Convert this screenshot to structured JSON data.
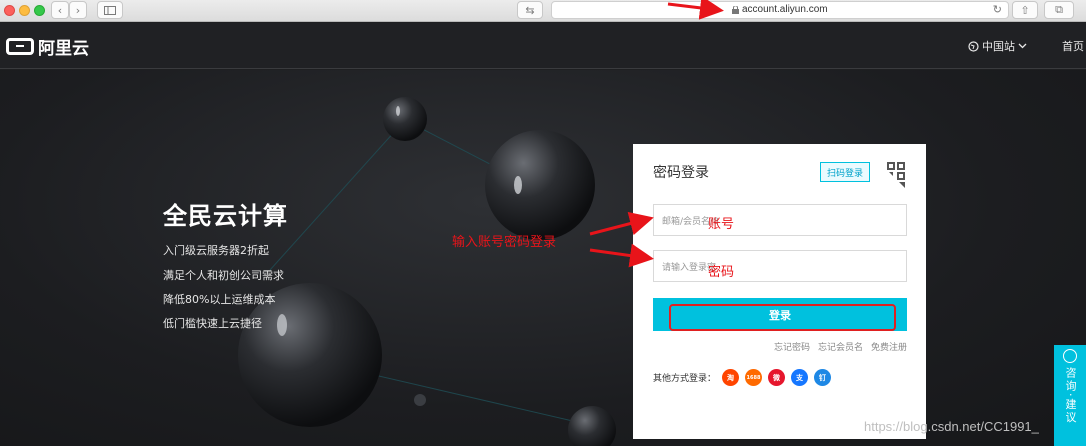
{
  "browser": {
    "url": "account.aliyun.com"
  },
  "header": {
    "logo_text": "阿里云",
    "region": "中国站",
    "home": "首页"
  },
  "hero": {
    "title": "全民云计算",
    "features": [
      "入门级云服务器2折起",
      "满足个人和初创公司需求",
      "降低80%以上运维成本",
      "低门槛快速上云捷径"
    ]
  },
  "login": {
    "title": "密码登录",
    "qr_tip": "扫码登录",
    "account_placeholder": "邮箱/会员名/8",
    "password_placeholder": "请输入登录密",
    "submit": "登录",
    "links": [
      "忘记密码",
      "忘记会员名",
      "免费注册"
    ],
    "other_label": "其他方式登录：",
    "social": [
      {
        "icon": "taobao-icon",
        "text": "淘",
        "color": "#ff4400"
      },
      {
        "icon": "1688-icon",
        "text": "1688",
        "color": "#ff6a00"
      },
      {
        "icon": "weibo-icon",
        "text": "微",
        "color": "#e6162d"
      },
      {
        "icon": "alipay-icon",
        "text": "支",
        "color": "#1677ff"
      },
      {
        "icon": "dingtalk-icon",
        "text": "钉",
        "color": "#1e88e5"
      }
    ]
  },
  "annotations": {
    "instruction": "输入账号密码登录",
    "account": "账号",
    "password": "密码"
  },
  "side": {
    "label": "咨询·建议"
  },
  "watermark": "https://blog.csdn.net/CC1991_",
  "colors": {
    "accent": "#00c1de",
    "annotation": "#e8141a"
  }
}
